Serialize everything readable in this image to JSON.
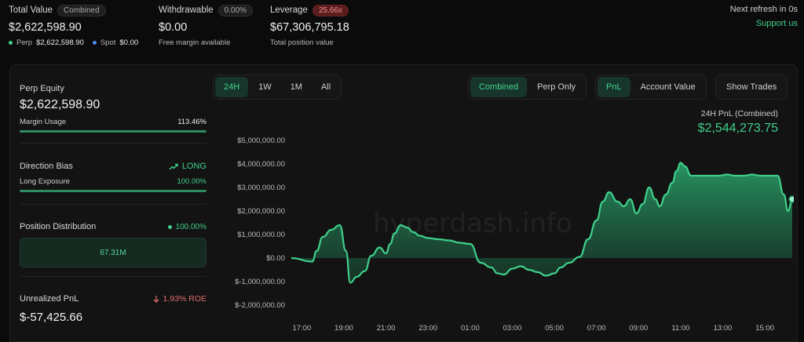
{
  "header": {
    "total_value": {
      "label": "Total Value",
      "badge": "Combined",
      "value": "$2,622,598.90",
      "perp_label": "Perp",
      "perp_value": "$2,622,598.90",
      "spot_label": "Spot",
      "spot_value": "$0.00"
    },
    "withdrawable": {
      "label": "Withdrawable",
      "badge": "0.00%",
      "value": "$0.00",
      "sub": "Free margin available"
    },
    "leverage": {
      "label": "Leverage",
      "badge": "25.66x",
      "value": "$67,306,795.18",
      "sub": "Total position value"
    },
    "refresh": "Next refresh in 0s",
    "support": "Support us"
  },
  "sidebar": {
    "perp_equity": {
      "title": "Perp Equity",
      "value": "$2,622,598.90",
      "margin_label": "Margin Usage",
      "margin_value": "113.46%",
      "margin_fill": 1.0
    },
    "direction": {
      "title": "Direction Bias",
      "bias": "LONG",
      "exposure_label": "Long Exposure",
      "exposure_value": "100.00%",
      "exposure_fill": 1.0
    },
    "distribution": {
      "title": "Position Distribution",
      "percent": "100.00%",
      "box_value": "67.31M"
    },
    "unrealized": {
      "title": "Unrealized PnL",
      "roe": "1.93% ROE",
      "value": "$-57,425.66"
    }
  },
  "controls": {
    "timeframes": [
      "24H",
      "1W",
      "1M",
      "All"
    ],
    "timeframe_active": "24H",
    "views": [
      "Combined",
      "Perp Only"
    ],
    "view_active": "Combined",
    "metrics": [
      "PnL",
      "Account Value"
    ],
    "metric_active": "PnL",
    "show_trades": "Show Trades"
  },
  "pnl_summary": {
    "label": "24H PnL (Combined)",
    "value": "$2,544,273.75"
  },
  "watermark": "hyperdash.info",
  "colors": {
    "accent": "#3fd08b",
    "negative": "#e06a6a",
    "background": "#0b0b0b"
  },
  "chart_data": {
    "type": "area",
    "xlabel": "",
    "ylabel": "",
    "ylim": [
      -2000000,
      5000000
    ],
    "y_ticks": [
      5000000,
      4000000,
      3000000,
      2000000,
      1000000,
      0,
      -1000000,
      -2000000
    ],
    "y_tick_labels": [
      "$5,000,000.00",
      "$4,000,000.00",
      "$3,000,000.00",
      "$2,000,000.00",
      "$1,000,000.00",
      "$0.00",
      "$-1,000,000.00",
      "$-2,000,000.00"
    ],
    "x_ticks": [
      1,
      3,
      5,
      7,
      9,
      11,
      13,
      15,
      17,
      19,
      21,
      23
    ],
    "x_tick_labels": [
      "17:00",
      "19:00",
      "21:00",
      "23:00",
      "01:00",
      "03:00",
      "05:00",
      "07:00",
      "09:00",
      "11:00",
      "13:00",
      "15:00"
    ],
    "xlim": [
      0.5,
      24.3
    ],
    "series": [
      {
        "x": [
          0.5,
          1.5,
          1.7,
          2.0,
          2.4,
          2.8,
          3.1,
          3.3,
          3.6,
          4.0,
          4.3,
          4.7,
          5.0,
          5.2,
          5.4,
          5.7,
          6.0,
          6.3,
          6.6,
          7.0,
          7.5,
          8.0,
          8.5,
          9.0,
          9.5,
          10.0,
          10.3,
          10.6,
          11.0,
          11.4,
          11.8,
          12.2,
          12.6,
          13.0,
          13.3,
          13.7,
          14.2,
          14.6,
          15.0,
          15.3,
          15.6,
          16.0,
          16.3,
          16.6,
          16.9,
          17.2,
          17.5,
          17.8,
          18.0,
          18.3,
          18.6,
          18.8,
          19.0,
          19.2,
          19.5,
          19.7,
          20.0,
          20.2,
          20.5,
          20.8,
          21.2,
          21.6,
          22.0,
          22.4,
          22.8,
          23.2,
          23.6,
          23.9,
          24.1,
          24.3
        ],
        "y": [
          0,
          -150000,
          300000,
          900000,
          1200000,
          1400000,
          300000,
          -1050000,
          -800000,
          -550000,
          100000,
          450000,
          200000,
          600000,
          1050000,
          1400000,
          1300000,
          1100000,
          950000,
          850000,
          800000,
          750000,
          650000,
          600000,
          -200000,
          -400000,
          -650000,
          -700000,
          -450000,
          -350000,
          -500000,
          -600000,
          -750000,
          -650000,
          -400000,
          -200000,
          50000,
          800000,
          1600000,
          2400000,
          2800000,
          2400000,
          2200000,
          2500000,
          1900000,
          2300000,
          3000000,
          2500000,
          2200000,
          2700000,
          3200000,
          3700000,
          4050000,
          3900000,
          3500000,
          3500000,
          3500000,
          3500000,
          3500000,
          3500000,
          3550000,
          3500000,
          3500000,
          3550000,
          3500000,
          3500000,
          3500000,
          2700000,
          2000000,
          2500000
        ]
      }
    ]
  }
}
